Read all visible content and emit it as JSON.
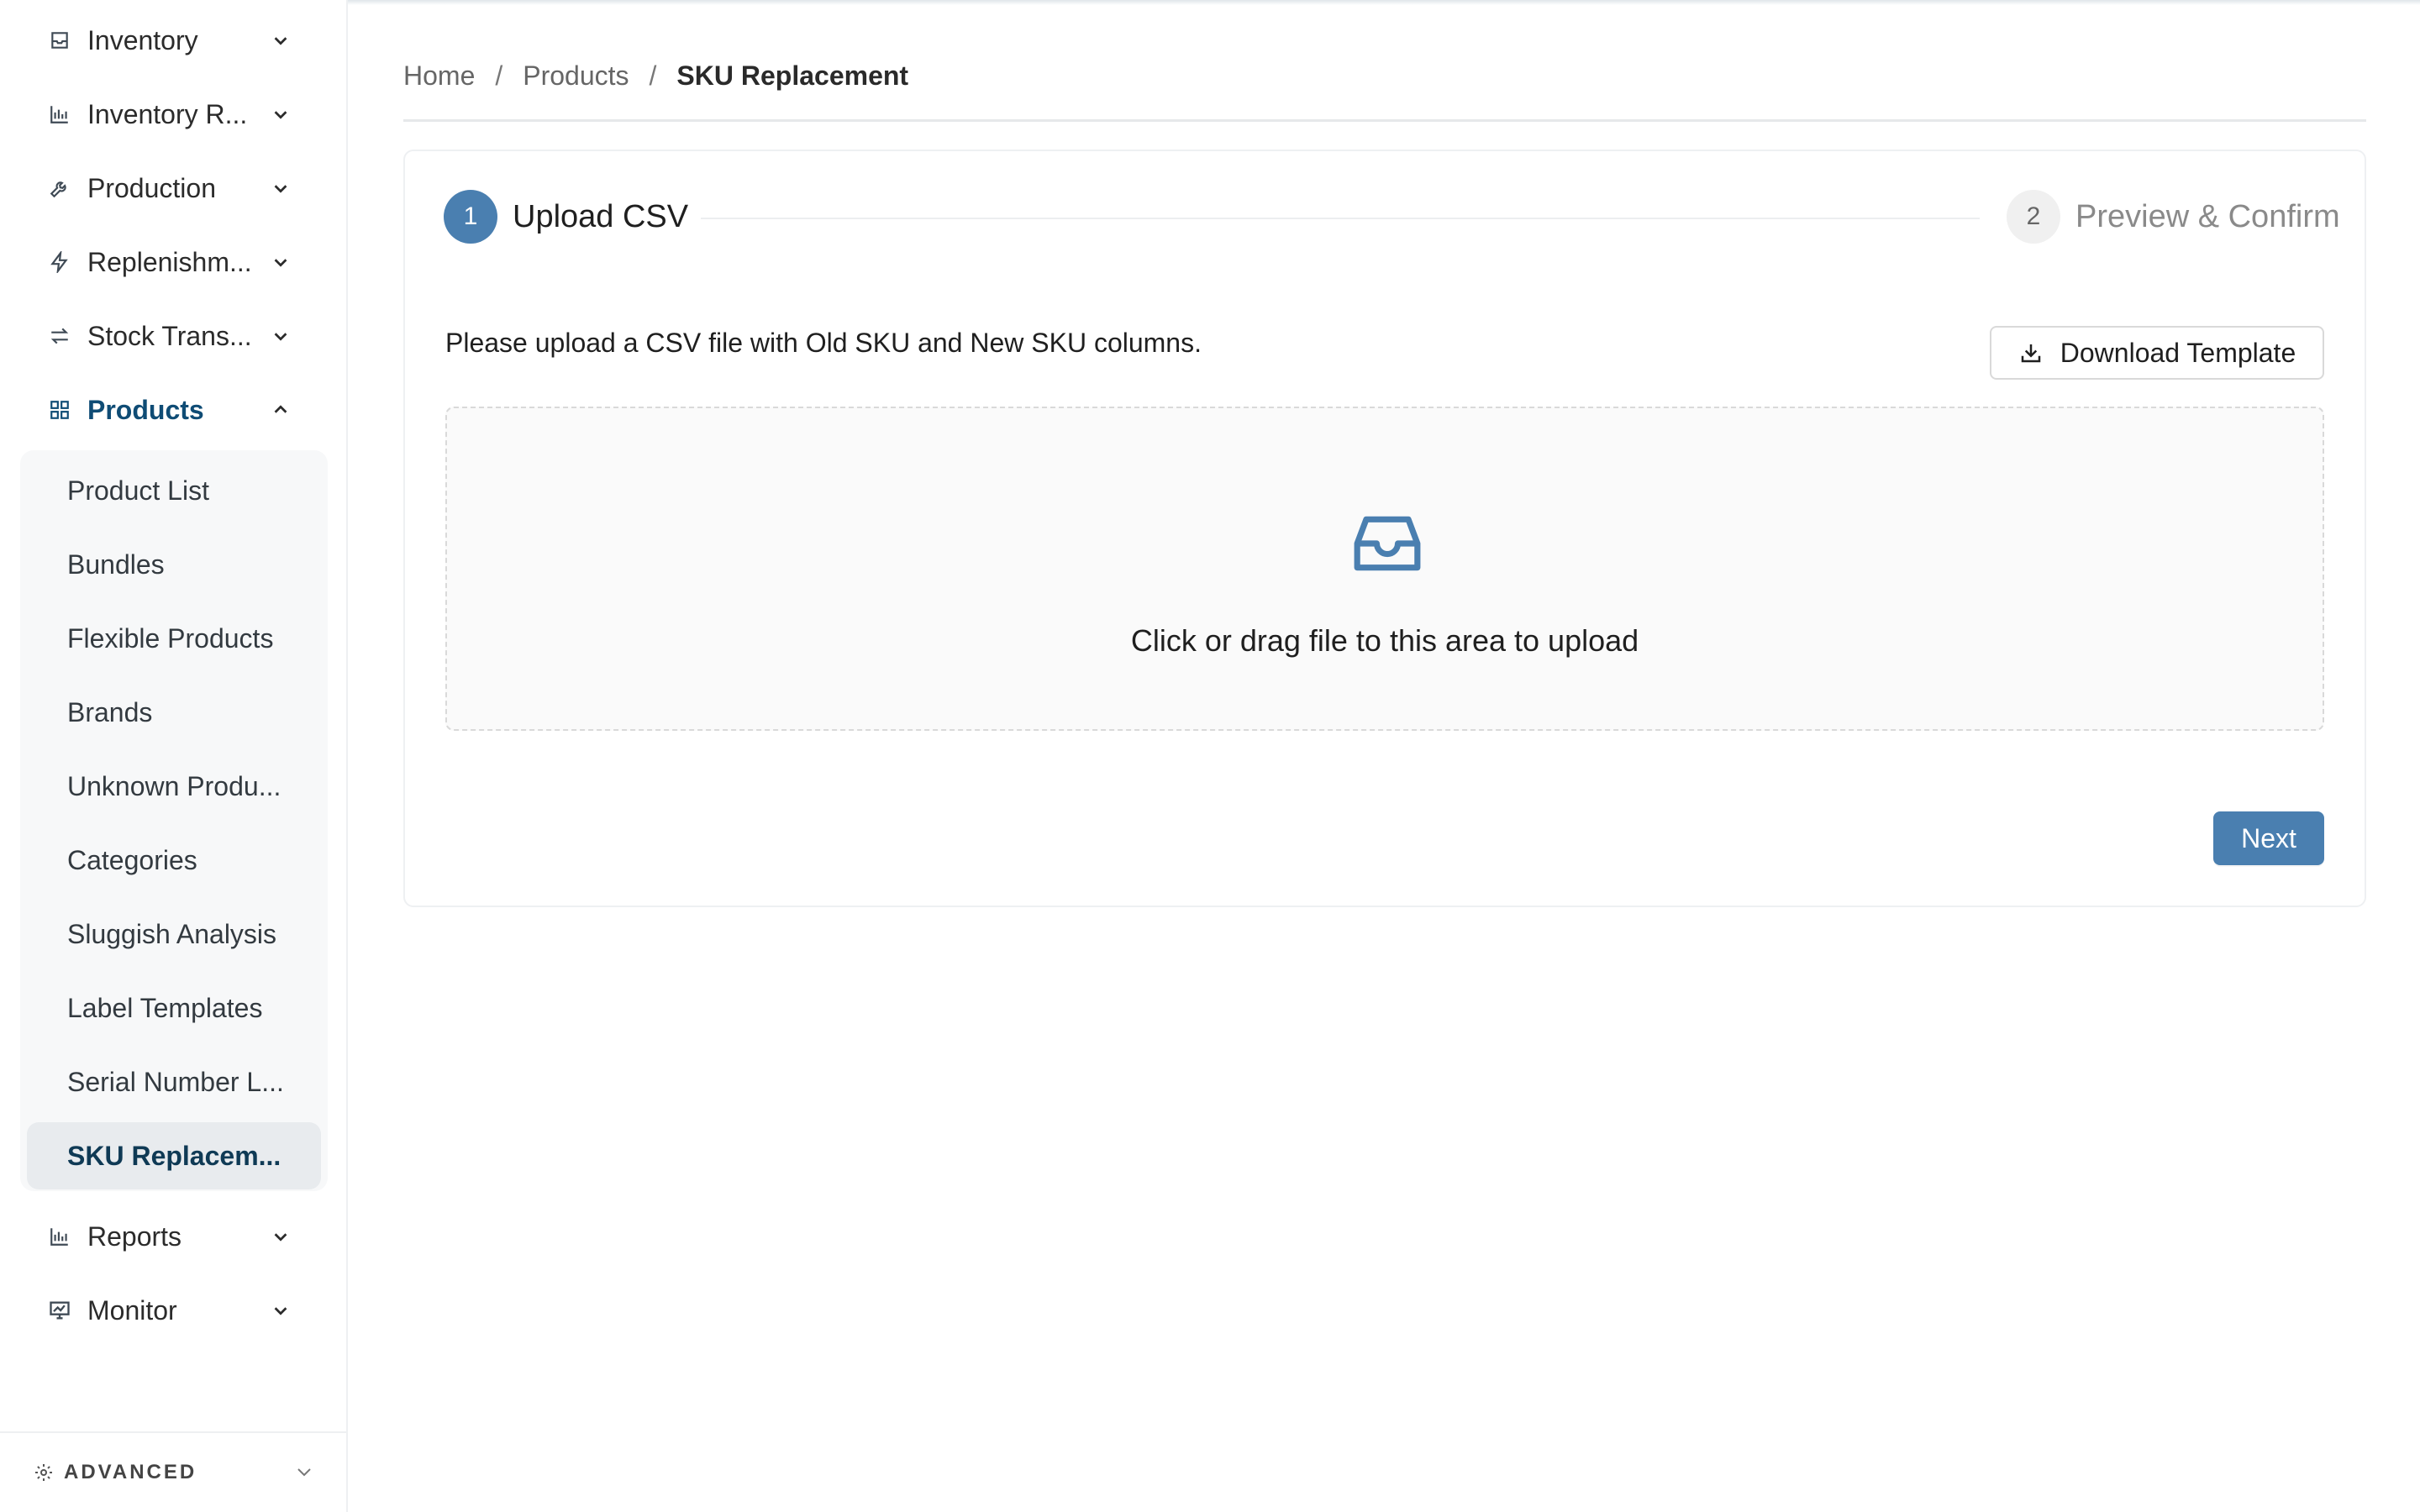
{
  "sidebar": {
    "nav": [
      {
        "label": "Inventory",
        "icon": "inbox-icon"
      },
      {
        "label": "Inventory R...",
        "icon": "bar-chart-icon"
      },
      {
        "label": "Production",
        "icon": "tool-icon"
      },
      {
        "label": "Replenishm...",
        "icon": "lightning-icon"
      },
      {
        "label": "Stock Trans...",
        "icon": "swap-icon"
      },
      {
        "label": "Products",
        "icon": "grid-icon"
      },
      {
        "label": "Reports",
        "icon": "bar-chart-icon"
      },
      {
        "label": "Monitor",
        "icon": "monitor-chart-icon"
      }
    ],
    "products_submenu": [
      "Product List",
      "Bundles",
      "Flexible Products",
      "Brands",
      "Unknown Produ...",
      "Categories",
      "Sluggish Analysis",
      "Label Templates",
      "Serial Number L...",
      "SKU Replacem..."
    ],
    "advanced_label": "ADVANCED"
  },
  "breadcrumb": {
    "home": "Home",
    "separator": "/",
    "products": "Products",
    "current": "SKU Replacement"
  },
  "steps": [
    {
      "number": "1",
      "title": "Upload CSV",
      "status": "active"
    },
    {
      "number": "2",
      "title": "Preview & Confirm",
      "status": "pending"
    }
  ],
  "upload": {
    "instructions": "Please upload a CSV file with Old SKU and New SKU columns.",
    "download_template_label": "Download Template",
    "dropzone_text": "Click or drag file to this area to upload"
  },
  "actions": {
    "next_label": "Next"
  },
  "colors": {
    "primary": "#4a7fb0",
    "active_nav": "#0f4c75"
  }
}
